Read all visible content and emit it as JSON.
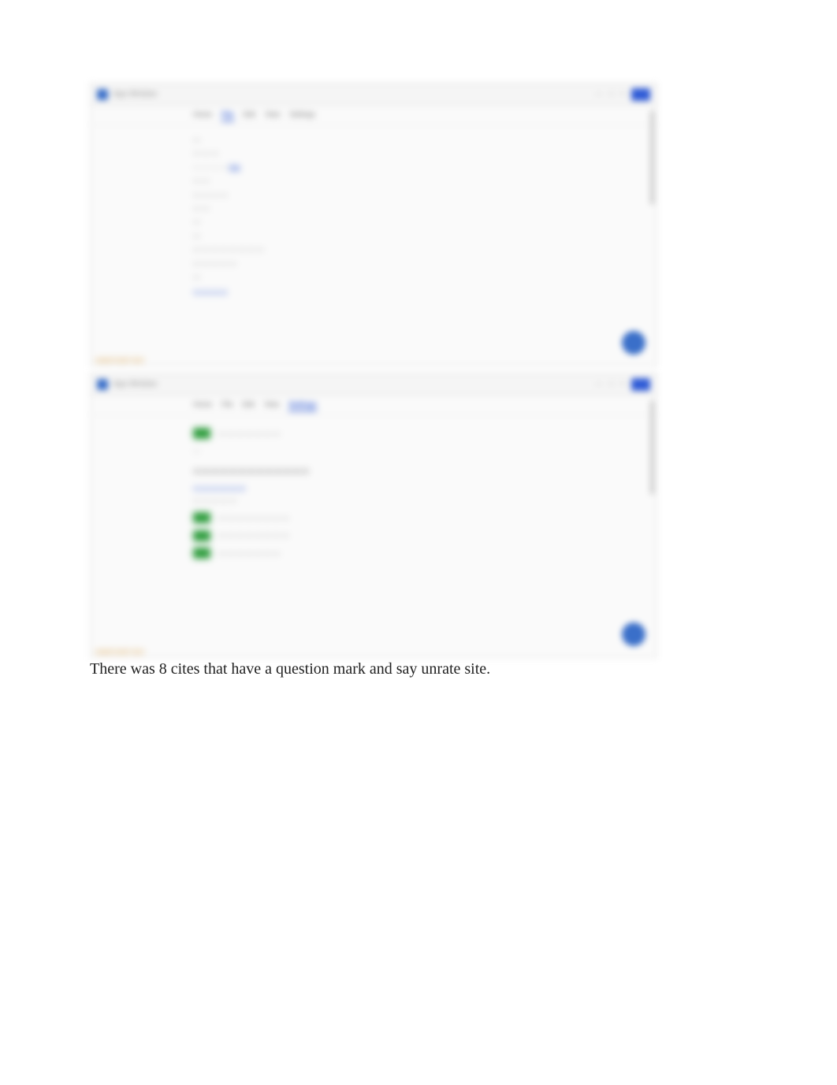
{
  "screenshot1": {
    "title_hint": "App Window",
    "tabs": [
      "Home",
      "File",
      "Edit",
      "View",
      "Settings"
    ],
    "active_tab_index": 1,
    "lines": [
      "—",
      "— — —",
      "— — — —",
      "",
      "— —",
      "— — — —",
      "— —",
      "—",
      "",
      "—",
      "— — — — — — — —",
      "",
      "— — — — —",
      "—",
      "",
      "— — — —"
    ],
    "watermark_hint": "watermark text"
  },
  "screenshot2": {
    "title_hint": "App Window",
    "tabs": [
      "Home",
      "File",
      "Edit",
      "View",
      "Settings"
    ],
    "active_tab_index": 4,
    "rows": [
      {
        "badge": "g",
        "text": "— — — — — — —"
      },
      {
        "badge": "",
        "text": ""
      },
      {
        "badge": "q",
        "text": "— — — — — — — — — — — — —"
      },
      {
        "badge": "",
        "text": "— — — — — —"
      },
      {
        "badge": "",
        "text": "— — — — —"
      },
      {
        "badge": "g",
        "text": "— — — — — — — —"
      },
      {
        "badge": "g",
        "text": "— — — — — — — —"
      },
      {
        "badge": "g",
        "text": "— — — — — — —"
      }
    ],
    "watermark_hint": "watermark text"
  },
  "caption": "There was 8 cites that have a question mark and say unrate site."
}
